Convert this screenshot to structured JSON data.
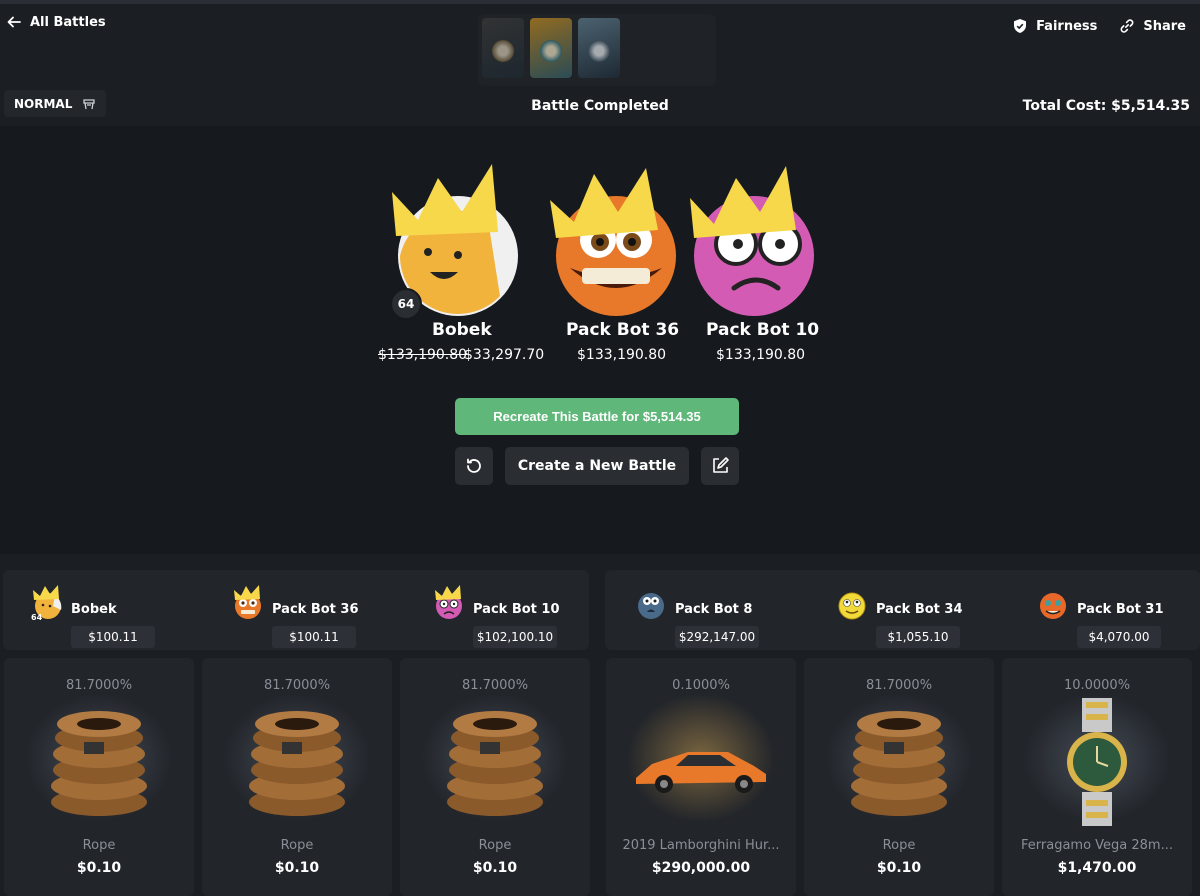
{
  "header": {
    "back_label": "All Battles",
    "fairness_label": "Fairness",
    "share_label": "Share",
    "mode_label": "NORMAL",
    "status": "Battle Completed",
    "total_cost": "Total Cost: $5,514.35"
  },
  "winners": [
    {
      "name": "Bobek",
      "old_amount": "$133,190.80",
      "amount": "$33,297.70",
      "level": "64"
    },
    {
      "name": "Pack Bot 36",
      "amount": "$133,190.80"
    },
    {
      "name": "Pack Bot 10",
      "amount": "$133,190.80"
    }
  ],
  "actions": {
    "recreate_label": "Recreate This Battle for $5,514.35",
    "new_battle_label": "Create a New Battle"
  },
  "teams": [
    {
      "players": [
        {
          "name": "Bobek",
          "value": "$100.11",
          "level": "64"
        },
        {
          "name": "Pack Bot 36",
          "value": "$100.11"
        },
        {
          "name": "Pack Bot 10",
          "value": "$102,100.10"
        }
      ]
    },
    {
      "players": [
        {
          "name": "Pack Bot 8",
          "value": "$292,147.00"
        },
        {
          "name": "Pack Bot 34",
          "value": "$1,055.10"
        },
        {
          "name": "Pack Bot 31",
          "value": "$4,070.00"
        }
      ]
    }
  ],
  "items": [
    {
      "chance": "81.7000%",
      "name": "Rope",
      "price": "$0.10"
    },
    {
      "chance": "81.7000%",
      "name": "Rope",
      "price": "$0.10"
    },
    {
      "chance": "81.7000%",
      "name": "Rope",
      "price": "$0.10"
    },
    {
      "chance": "0.1000%",
      "name": "2019 Lamborghini Hur...",
      "price": "$290,000.00"
    },
    {
      "chance": "81.7000%",
      "name": "Rope",
      "price": "$0.10"
    },
    {
      "chance": "10.0000%",
      "name": "Ferragamo Vega 28m...",
      "price": "$1,470.00"
    }
  ],
  "colors": {
    "accent_green": "#5fb87a",
    "crown_yellow": "#f6d84a",
    "background": "#16191d"
  },
  "icons": [
    "arrow-left-icon",
    "shield-check-icon",
    "link-icon",
    "mode-icon",
    "refresh-icon",
    "edit-icon",
    "crown-icon"
  ]
}
